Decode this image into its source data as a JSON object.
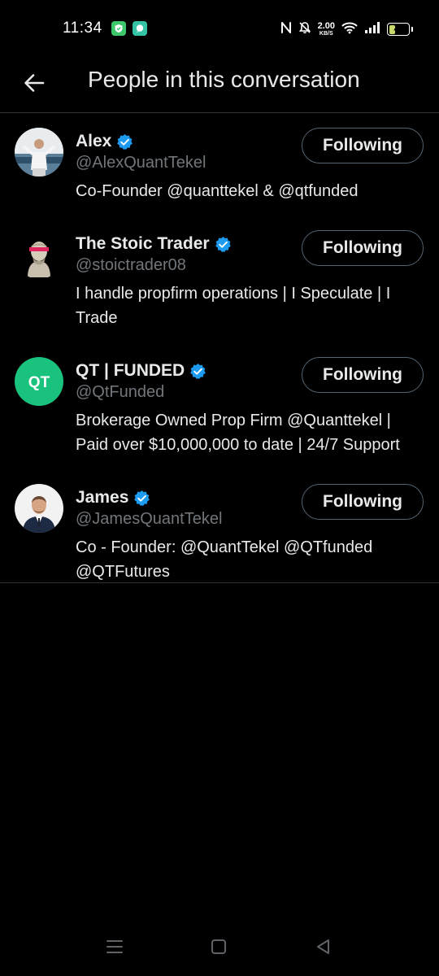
{
  "status_bar": {
    "time": "11:34",
    "net_speed_value": "2.00",
    "net_speed_unit": "KB/S",
    "battery_level": "41",
    "battery_fraction": 0.41,
    "icons": [
      "shield-app-icon",
      "chat-app-icon",
      "nfc-icon",
      "mute-bell-icon",
      "wifi-icon",
      "signal-icon",
      "battery-icon"
    ]
  },
  "header": {
    "back_icon": "arrow-left-icon",
    "title": "People in this conversation"
  },
  "people": [
    {
      "name": "Alex",
      "handle": "@AlexQuantTekel",
      "bio": "Co-Founder @quanttekel & @qtfunded",
      "verified": true,
      "follow_label": "Following"
    },
    {
      "name": "The Stoic Trader",
      "handle": "@stoictrader08",
      "bio": "I handle propfirm operations | I Speculate | I Trade",
      "verified": true,
      "follow_label": "Following"
    },
    {
      "name": "QT | FUNDED",
      "handle": "@QtFunded",
      "avatar_text": "QT",
      "bio": "Brokerage Owned Prop Firm @Quanttekel | Paid over $10,000,000 to date | 24/7 Support",
      "verified": true,
      "follow_label": "Following"
    },
    {
      "name": "James",
      "handle": "@JamesQuantTekel",
      "bio": "Co - Founder:  @QuantTekel @QTfunded @QTFutures",
      "verified": true,
      "follow_label": "Following"
    }
  ],
  "nav_bar": {
    "icons": [
      "recents-menu-icon",
      "home-square-icon",
      "back-triangle-icon"
    ]
  },
  "colors": {
    "background": "#000000",
    "text_primary": "#e7e9ea",
    "text_secondary": "#71767b",
    "divider": "#2f3336",
    "verified_blue": "#1d9bf0",
    "qt_green": "#19c37d"
  }
}
